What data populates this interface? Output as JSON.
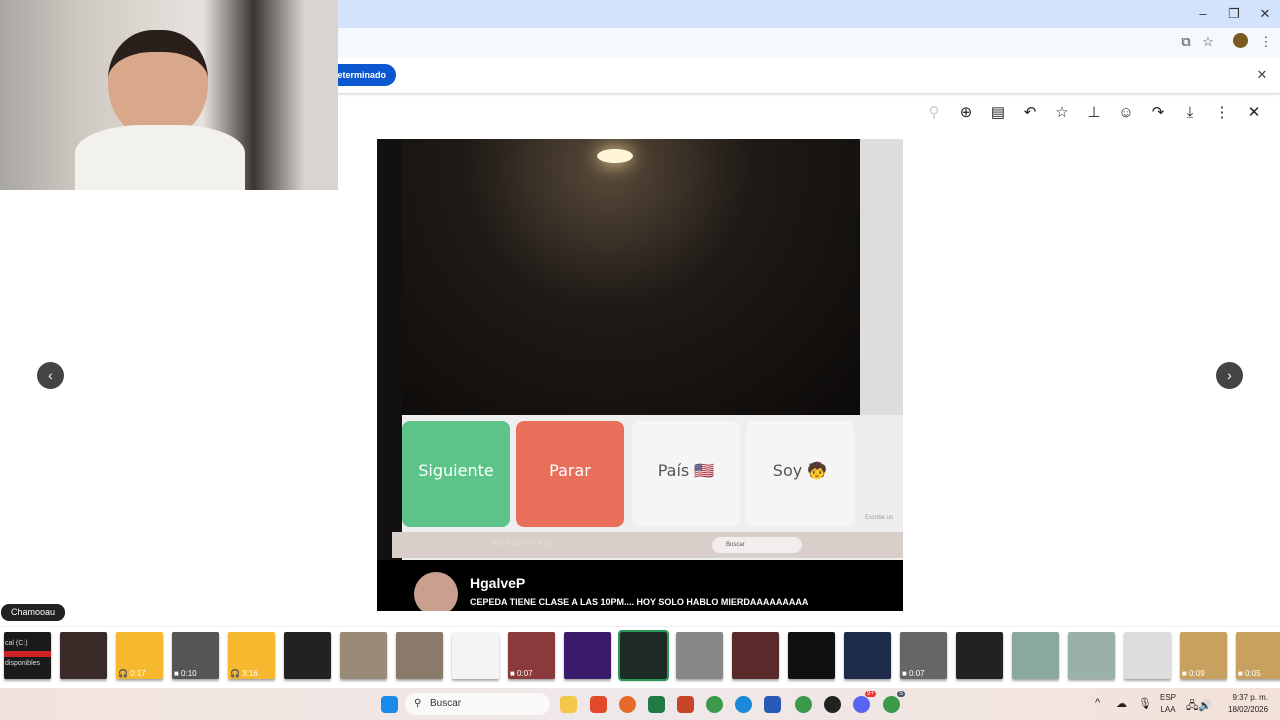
{
  "browser": {
    "window_controls": [
      "minimize",
      "restore",
      "close"
    ],
    "info_button": "determinado",
    "info_close": "close"
  },
  "viewer": {
    "toolbar": [
      "zoom-out-icon",
      "zoom-in-icon",
      "caption-icon",
      "reply-icon",
      "star-icon",
      "pin-icon",
      "emoji-icon",
      "forward-icon",
      "download-icon",
      "more-icon",
      "close-icon"
    ],
    "prev": "‹",
    "next": "›"
  },
  "photo": {
    "buttons": {
      "next": "Siguiente",
      "stop": "Parar",
      "country": "País 🇺🇸",
      "i_am": "Soy 🧒"
    },
    "mini_search": "Buscar",
    "chat_user": "HgalveP",
    "chat_message": "CEPEDA TIENE CLASE A LAS 10PM.... HOY SOLO HABLO MIERDAAAAAAAAA",
    "mini_time": "01:04:23 / 01:04:03",
    "side_hint": "Escribe un"
  },
  "tooltip": "Chamooau",
  "thumbnails": [
    {
      "color": "#1a1a1a",
      "text1": "cal (C:)",
      "text2": "disponibles"
    },
    {
      "color": "#3a2a28",
      "badge": ""
    },
    {
      "color": "#f5b82e",
      "badge": "🎧 0:17"
    },
    {
      "color": "#555",
      "badge": "■ 0:10"
    },
    {
      "color": "#f5b82e",
      "badge": "🎧 3:16"
    },
    {
      "color": "#222",
      "badge": ""
    },
    {
      "color": "#9a8a78",
      "badge": ""
    },
    {
      "color": "#8a7a6a",
      "badge": ""
    },
    {
      "color": "#f4f4f4",
      "badge": ""
    },
    {
      "color": "#8a3a3a",
      "badge": "■ 0:07"
    },
    {
      "color": "#3a1a6a",
      "badge": ""
    },
    {
      "color": "#1e2a24",
      "badge": "",
      "selected": true
    },
    {
      "color": "#888",
      "badge": ""
    },
    {
      "color": "#5a2a2a",
      "badge": ""
    },
    {
      "color": "#111",
      "badge": ""
    },
    {
      "color": "#1e2a4a",
      "badge": ""
    },
    {
      "color": "#666",
      "badge": "■ 0:07"
    },
    {
      "color": "#222",
      "badge": ""
    },
    {
      "color": "#8aa8a0",
      "badge": ""
    },
    {
      "color": "#9ab0aa",
      "badge": ""
    },
    {
      "color": "#ddd",
      "badge": ""
    },
    {
      "color": "#c8a060",
      "badge": "■ 0:09"
    },
    {
      "color": "#c8a060",
      "badge": "■ 0:05"
    }
  ],
  "taskbar": {
    "search": "Buscar",
    "lang1": "ESP",
    "lang2": "LAA",
    "time": "9:37 p. m.",
    "date": "18/02/2026",
    "discord_badge": "9+",
    "chrome_badge": "S"
  }
}
